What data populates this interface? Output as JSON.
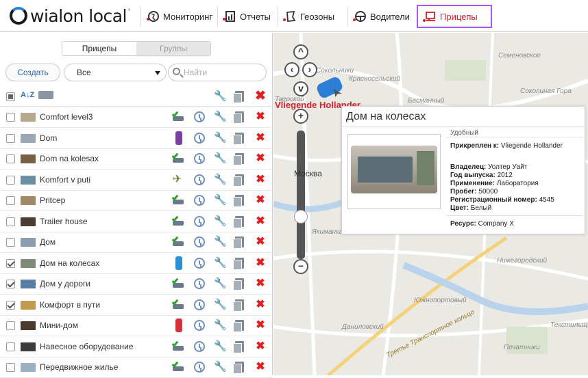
{
  "app": {
    "logo_text": "wialon local",
    "logo_suffix": "'"
  },
  "nav": {
    "items": [
      {
        "label": "Мониторинг",
        "icon": "globe-icon"
      },
      {
        "label": "Отчеты",
        "icon": "report-icon"
      },
      {
        "label": "Геозоны",
        "icon": "geofence-icon"
      },
      {
        "label": "Водители",
        "icon": "driver-icon"
      },
      {
        "label": "Прицепы",
        "icon": "trailer-icon",
        "active": true
      }
    ]
  },
  "left": {
    "tabs": [
      "Прицепы",
      "Группы"
    ],
    "create_label": "Создать",
    "filter_value": "Все",
    "search_placeholder": "Найти",
    "sort_label": "A↓Z",
    "rows": [
      {
        "name": "Comfort level3",
        "checked": false,
        "state": "connected"
      },
      {
        "name": "Dom",
        "checked": false,
        "state": "phone-purple"
      },
      {
        "name": "Dom na kolesax",
        "checked": false,
        "state": "connected"
      },
      {
        "name": "Komfort v puti",
        "checked": false,
        "state": "plane"
      },
      {
        "name": "Pritcep",
        "checked": false,
        "state": "connected"
      },
      {
        "name": "Trailer house",
        "checked": false,
        "state": "connected"
      },
      {
        "name": "Дом",
        "checked": false,
        "state": "connected"
      },
      {
        "name": "Дом на колесах",
        "checked": true,
        "state": "phone-blue"
      },
      {
        "name": "Дом у дороги",
        "checked": true,
        "state": "connected"
      },
      {
        "name": "Комфорт в пути",
        "checked": true,
        "state": "connected"
      },
      {
        "name": "Мини-дом",
        "checked": false,
        "state": "phone-red"
      },
      {
        "name": "Навесное оборудование",
        "checked": false,
        "state": "connected"
      },
      {
        "name": "Передвижное жилье",
        "checked": false,
        "state": "connected"
      }
    ]
  },
  "map": {
    "labels": [
      "Семеновское",
      "Сокольники",
      "Красносельский",
      "Басманный",
      "Соколиная Гора",
      "Тверской",
      "Якиманка",
      "Нижегородский",
      "Южнопортовый",
      "Текстильщики",
      "Даниловский",
      "Третье Транспортное кольцо",
      "Печатники"
    ],
    "city": "Москва",
    "unit_label": "Vliegende Hollander",
    "popup": {
      "title": "Дом на колесах",
      "header": "Удобный",
      "attached_label": "Прикреплен к:",
      "attached_value": "Vliegende Hollander",
      "owner_label": "Владелец:",
      "owner_value": "Уолтер Уайт",
      "year_label": "Год выпуска:",
      "year_value": "2012",
      "usage_label": "Применение:",
      "usage_value": "Лаборатория",
      "mileage_label": "Пробег:",
      "mileage_value": "50000",
      "reg_label": "Регистрационный номер:",
      "reg_value": "4545",
      "color_label": "Цвет:",
      "color_value": "Белый",
      "resource_label": "Ресурс:",
      "resource_value": "Company X"
    }
  },
  "colors": {
    "active_border": "#a855f7",
    "accent_red": "#d6202a",
    "link_blue": "#2b6cb8"
  }
}
